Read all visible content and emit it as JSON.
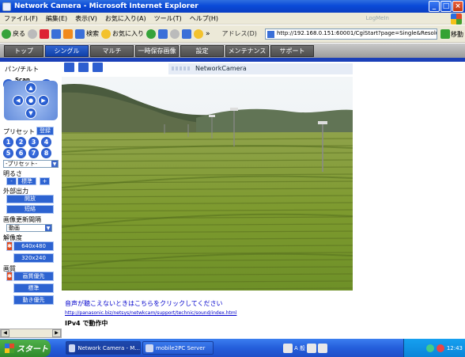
{
  "window": {
    "title": "Network Camera - Microsoft Internet Explorer",
    "minimize": "_",
    "maximize": "□",
    "close": "×"
  },
  "menubar": {
    "items": [
      "ファイル(F)",
      "編集(E)",
      "表示(V)",
      "お気に入り(A)",
      "ツール(T)",
      "ヘルプ(H)"
    ],
    "overlay_text": "LogMeIn"
  },
  "toolbar": {
    "back": "戻る",
    "search": "検索",
    "favorites": "お気に入り",
    "address_label": "アドレス(D)",
    "address_value": "http://192.168.0.151:60001/CgiStart?page=Single&Resolution=640",
    "go": "移動",
    "chevron": "»"
  },
  "nav": {
    "tabs": [
      "トップ",
      "シングル",
      "マルチ",
      "一時保存画像",
      "設定",
      "メンテナンス",
      "サポート"
    ],
    "active_index": 1
  },
  "controls": {
    "pan_tilt_label": "パン/チルト",
    "scan_label": "Scan",
    "preset_label": "プリセット",
    "register_button": "登録",
    "preset_numbers": [
      "1",
      "2",
      "3",
      "4",
      "5",
      "6",
      "7",
      "8"
    ],
    "preset_select": "-プリセット-",
    "brightness_label": "明るさ",
    "brightness_minus": "-",
    "brightness_std": "標準",
    "brightness_plus": "+",
    "external_output_label": "外部出力",
    "open_button": "開放",
    "short_button": "短絡",
    "refresh_label": "画像更新間隔",
    "refresh_select": "動画",
    "resolution_label": "解像度",
    "res_640": "640x480",
    "res_320": "320x240",
    "quality_label": "画質",
    "quality_priority": "画質優先",
    "quality_std": "標準",
    "motion_priority": "動き優先"
  },
  "camera": {
    "name": "NetworkCamera"
  },
  "links": {
    "sound_notice": "音声が聴こえないときはこちらをクリックしてください",
    "sound_url": "http://panasonic.biz/netsys/netwkcam/support/technic/sound/index.html",
    "ipv4_status": "IPv4 で動作中"
  },
  "taskbar": {
    "start": "スタート",
    "tasks": [
      "Network Camera - M...",
      "mobile2PC Server"
    ],
    "ime_text": "A 般",
    "clock": "12:43"
  }
}
